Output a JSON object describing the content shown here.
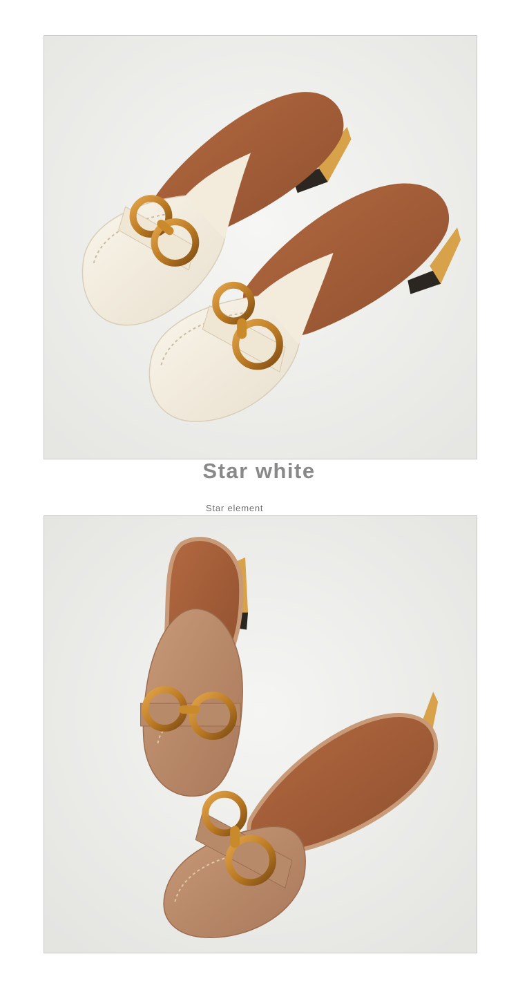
{
  "captions": {
    "title": "Star white",
    "subtitle": "Star element"
  },
  "colors": {
    "background": "#ffffff",
    "frame_border": "#c9c9c9",
    "title_text": "#898989",
    "subtitle_text": "#6d6d6d",
    "white_variant_upper": "#f1ebde",
    "tan_variant_upper": "#b98a6a",
    "insole": "#a05d38",
    "buckle_gold": "#c0852b"
  },
  "photos": [
    {
      "name": "Star white mules",
      "variant": "white"
    },
    {
      "name": "Tan mules",
      "variant": "tan"
    }
  ]
}
